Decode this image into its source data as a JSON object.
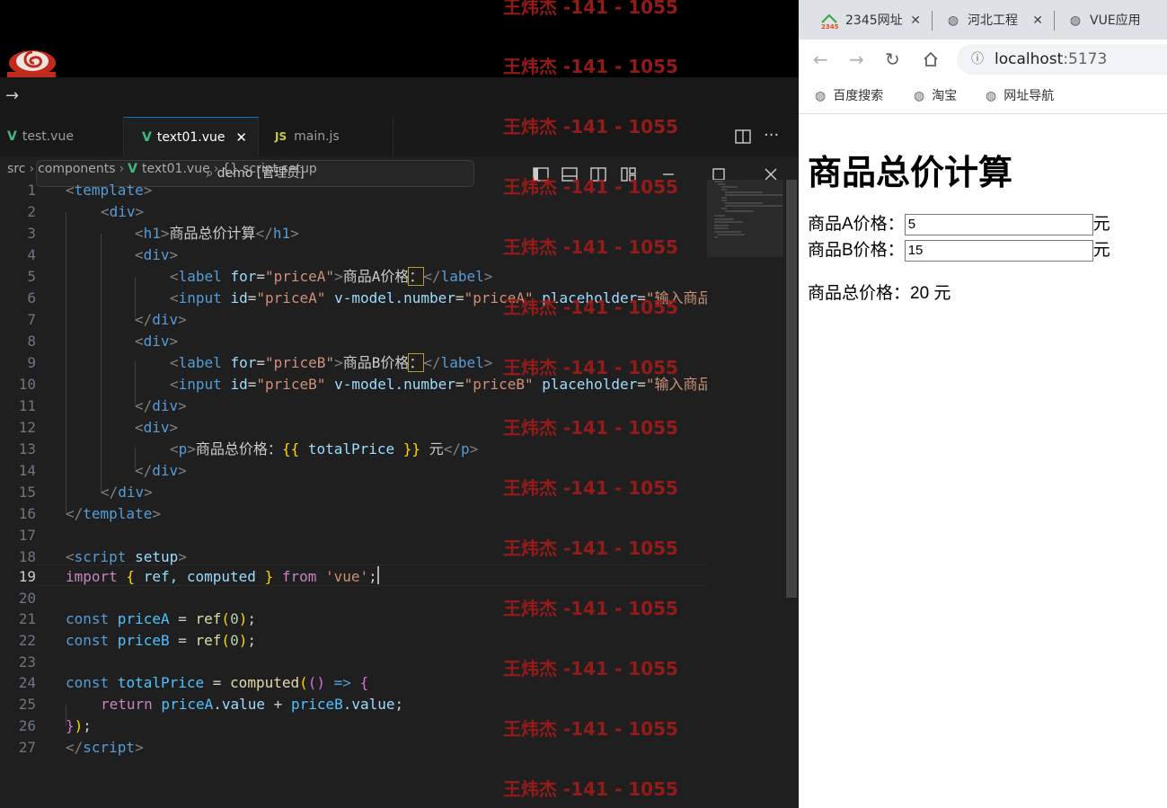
{
  "vscode": {
    "command_center": "demo [管理员]",
    "tabs": [
      {
        "icon": "V",
        "label": "test.vue",
        "active": false
      },
      {
        "icon": "V",
        "label": "text01.vue",
        "active": true
      },
      {
        "icon": "JS",
        "label": "main.js",
        "active": false
      }
    ],
    "breadcrumb": [
      "src",
      "components",
      "text01.vue",
      "script setup"
    ],
    "line_numbers": [
      "1",
      "2",
      "3",
      "4",
      "5",
      "6",
      "7",
      "8",
      "9",
      "10",
      "11",
      "12",
      "13",
      "14",
      "15",
      "16",
      "17",
      "18",
      "19",
      "20",
      "21",
      "22",
      "23",
      "24",
      "25",
      "26",
      "27"
    ],
    "current_line": "19",
    "code": {
      "l1": {
        "lt": "<",
        "tag": "template",
        "gt": ">"
      },
      "l2": {
        "lt": "<",
        "tag": "div",
        "gt": ">"
      },
      "l3": {
        "lt": "<",
        "tag": "h1",
        "gt": ">",
        "text": "商品总价计算",
        "close_lt": "</",
        "close_tag": "h1",
        "close_gt": ">"
      },
      "l4": {
        "lt": "<",
        "tag": "div",
        "gt": ">"
      },
      "l5": {
        "lt": "<",
        "tag": "label",
        "sp": " ",
        "attr": "for",
        "eq": "=",
        "val": "\"priceA\"",
        "gt": ">",
        "text": "商品A价格",
        "colon": "：",
        "close_lt": "</",
        "close_tag": "label",
        "close_gt": ">"
      },
      "l6": {
        "lt": "<",
        "tag": "input",
        "attr1": "id",
        "val1": "\"priceA\"",
        "attr2": "v-model.number",
        "val2": "\"priceA\"",
        "attr3": "placeholder",
        "val3": "\"输入商品"
      },
      "l7": {
        "lt": "</",
        "tag": "div",
        "gt": ">"
      },
      "l8": {
        "lt": "<",
        "tag": "div",
        "gt": ">"
      },
      "l9": {
        "lt": "<",
        "tag": "label",
        "sp": " ",
        "attr": "for",
        "eq": "=",
        "val": "\"priceB\"",
        "gt": ">",
        "text": "商品B价格",
        "colon": "：",
        "close_lt": "</",
        "close_tag": "label",
        "close_gt": ">"
      },
      "l10": {
        "lt": "<",
        "tag": "input",
        "attr1": "id",
        "val1": "\"priceB\"",
        "attr2": "v-model.number",
        "val2": "\"priceB\"",
        "attr3": "placeholder",
        "val3": "\"输入商品"
      },
      "l11": {
        "lt": "</",
        "tag": "div",
        "gt": ">"
      },
      "l12": {
        "lt": "<",
        "tag": "div",
        "gt": ">"
      },
      "l13": {
        "lt": "<",
        "tag": "p",
        "gt": ">",
        "text": "商品总价格：",
        "open": "{{",
        "expr": " totalPrice ",
        "close": "}}",
        "tail": " 元",
        "close_lt": "</",
        "close_tag": "p",
        "close_gt": ">"
      },
      "l14": {
        "lt": "</",
        "tag": "div",
        "gt": ">"
      },
      "l15": {
        "lt": "</",
        "tag": "div",
        "gt": ">"
      },
      "l16": {
        "lt": "</",
        "tag": "template",
        "gt": ">"
      },
      "l18": {
        "lt": "<",
        "tag": "script",
        "attr": " setup",
        "gt": ">"
      },
      "l19": {
        "kw1": "import",
        "ob": " { ",
        "ids": "ref, computed",
        "cb": " } ",
        "kw2": "from",
        "str": " 'vue'",
        "semi": ";"
      },
      "l21": {
        "kw": "const",
        "name": " priceA",
        "eq": " = ",
        "fn": "ref",
        "op": "(",
        "num": "0",
        "cp": ")",
        "semi": ";"
      },
      "l22": {
        "kw": "const",
        "name": " priceB",
        "eq": " = ",
        "fn": "ref",
        "op": "(",
        "num": "0",
        "cp": ")",
        "semi": ";"
      },
      "l24": {
        "kw": "const",
        "name": " totalPrice",
        "eq": " = ",
        "fn": "computed",
        "op": "(",
        "po": "(",
        "pc": ")",
        "arrow": " => ",
        "ob": "{"
      },
      "l25": {
        "kw": "return",
        "a": " priceA",
        "av": ".value",
        "plus": " + ",
        "b": "priceB",
        "bv": ".value",
        "semi": ";"
      },
      "l26": {
        "cb": "}",
        "cp": ")",
        "semi": ";"
      },
      "l27": {
        "lt": "</",
        "tag": "script",
        "gt": ">"
      }
    }
  },
  "watermark": "王炜杰 -141 - 1055",
  "browser": {
    "tabs": [
      {
        "label": "2345网址",
        "icon": "2345-logo-icon"
      },
      {
        "label": "河北工程",
        "icon": "globe-icon"
      },
      {
        "label": "VUE应用",
        "icon": "globe-icon"
      }
    ],
    "url_host": "localhost",
    "url_port": ":5173",
    "bookmarks": [
      "百度搜索",
      "淘宝",
      "网址导航"
    ],
    "page": {
      "title": "商品总价计算",
      "label_a": "商品A价格：",
      "value_a": "5",
      "label_b": "商品B价格：",
      "value_b": "15",
      "unit": "元",
      "total_label": "商品总价格：",
      "total_value": "20",
      "total_unit": " 元"
    }
  },
  "colors": {
    "accent": "#0078d4",
    "vue_green": "#42b883",
    "watermark": "#9c1b1b"
  }
}
